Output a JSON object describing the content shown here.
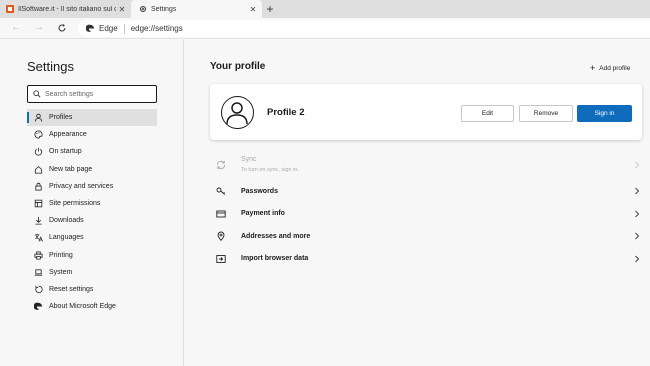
{
  "tabs": [
    {
      "title": "IlSoftware.it - Il sito italiano sul c",
      "icon": "ilsoftware-favicon",
      "active": false
    },
    {
      "title": "Settings",
      "icon": "gear-icon",
      "active": true
    }
  ],
  "address_bar": {
    "site": "Edge",
    "url": "edge://settings"
  },
  "sidebar": {
    "title": "Settings",
    "search_placeholder": "Search settings",
    "items": [
      {
        "label": "Profiles",
        "icon": "person-icon",
        "active": true
      },
      {
        "label": "Appearance",
        "icon": "palette-icon"
      },
      {
        "label": "On startup",
        "icon": "power-icon"
      },
      {
        "label": "New tab page",
        "icon": "home-icon"
      },
      {
        "label": "Privacy and services",
        "icon": "lock-icon"
      },
      {
        "label": "Site permissions",
        "icon": "site-permissions-icon"
      },
      {
        "label": "Downloads",
        "icon": "download-icon"
      },
      {
        "label": "Languages",
        "icon": "languages-icon"
      },
      {
        "label": "Printing",
        "icon": "printer-icon"
      },
      {
        "label": "System",
        "icon": "laptop-icon"
      },
      {
        "label": "Reset settings",
        "icon": "reset-icon"
      },
      {
        "label": "About Microsoft Edge",
        "icon": "edge-icon"
      }
    ]
  },
  "main": {
    "title": "Your profile",
    "add_profile": "Add profile",
    "profile": {
      "name": "Profile 2",
      "edit": "Edit",
      "remove": "Remove",
      "sign_in": "Sign in"
    },
    "rows": [
      {
        "label": "Sync",
        "sub": "To turn on sync, sign in.",
        "icon": "sync-icon",
        "disabled": true
      },
      {
        "label": "Passwords",
        "icon": "key-icon"
      },
      {
        "label": "Payment info",
        "icon": "card-icon"
      },
      {
        "label": "Addresses and more",
        "icon": "location-icon"
      },
      {
        "label": "Import browser data",
        "icon": "import-icon"
      }
    ]
  },
  "colors": {
    "accent": "#0f6cbd",
    "sidebar_bg": "#f7f7f7",
    "active_item_bg": "#e0e0e0"
  }
}
